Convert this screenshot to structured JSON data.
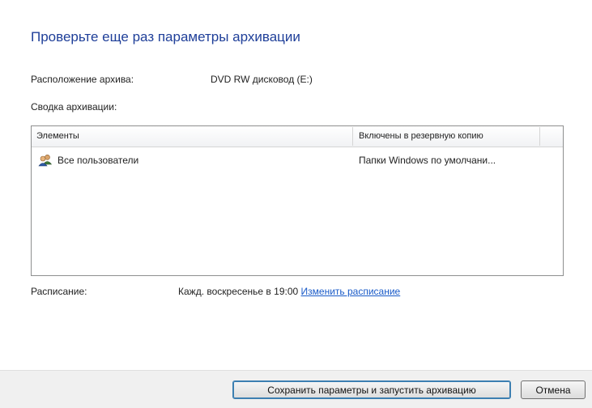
{
  "title": "Проверьте еще раз параметры архивации",
  "location": {
    "label": "Расположение архива:",
    "value": "DVD RW дисковод (E:)"
  },
  "summary": {
    "label": "Сводка архивации:"
  },
  "table": {
    "columns": [
      "Элементы",
      "Включены в резервную копию"
    ],
    "rows": [
      {
        "item": "Все пользователи",
        "included": "Папки Windows по умолчани..."
      }
    ]
  },
  "schedule": {
    "label": "Расписание:",
    "value": "Кажд. воскресенье в 19:00",
    "change_link": "Изменить расписание"
  },
  "buttons": {
    "save_run": "Сохранить параметры и запустить архивацию",
    "cancel": "Отмена"
  },
  "colors": {
    "title": "#1f3f99",
    "link": "#1a5bc8",
    "footer": "#f0f0f0"
  },
  "icons": {
    "user_group": "users-icon"
  }
}
